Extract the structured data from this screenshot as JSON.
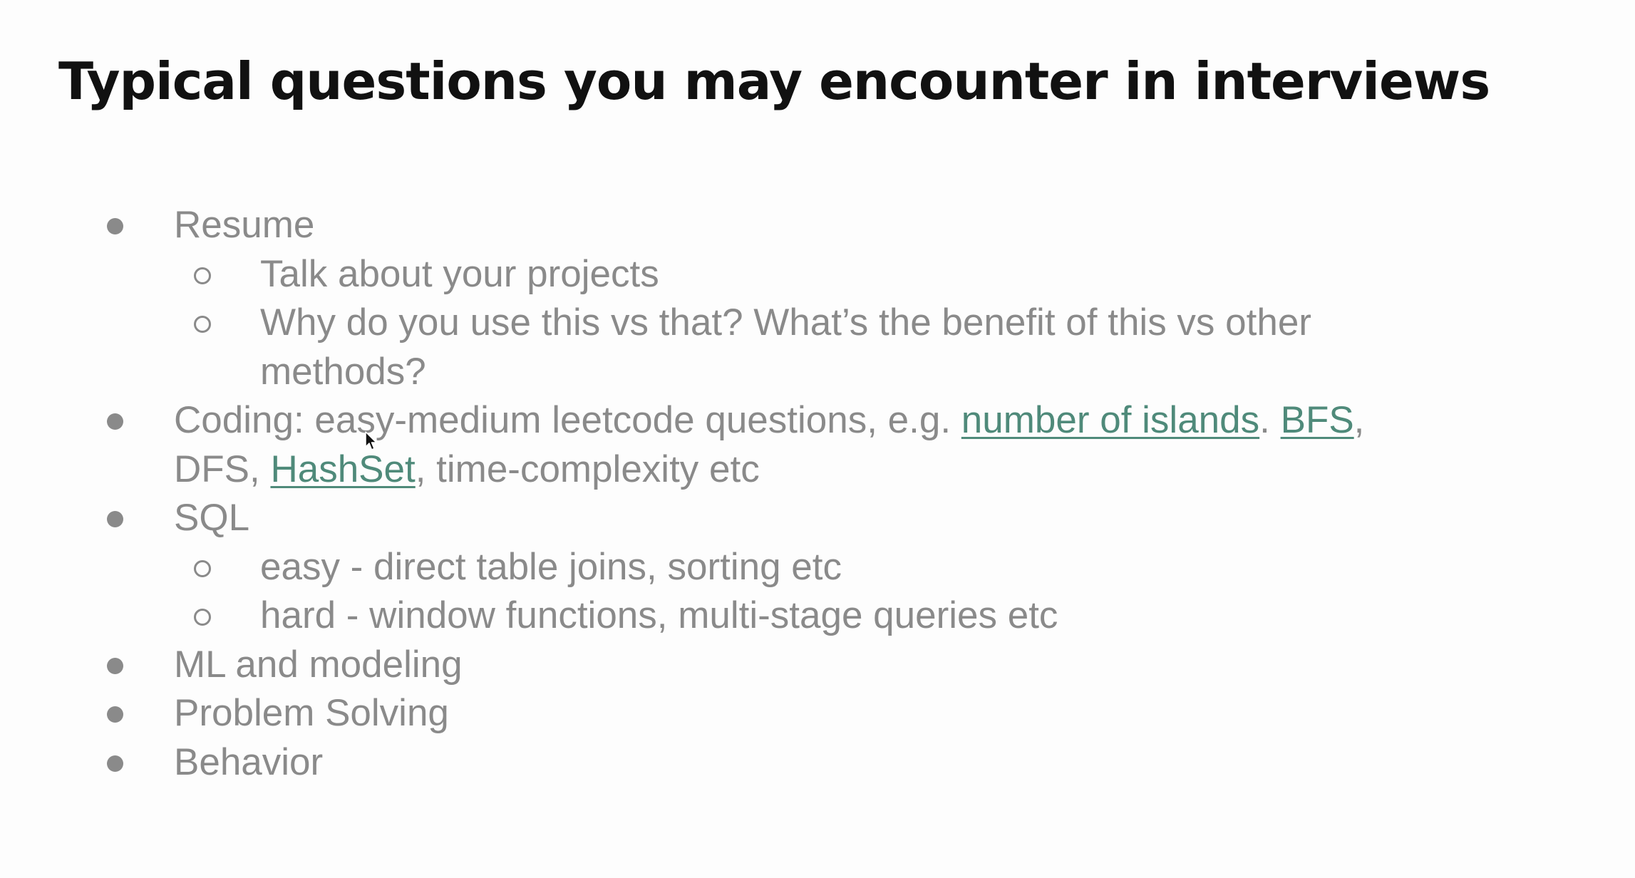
{
  "slide": {
    "title": "Typical questions you may encounter in interviews",
    "items": {
      "resume": {
        "label": "Resume",
        "sub1": "Talk about your projects",
        "sub2_line1": "Why do you use this vs that? What’s the benefit of this vs other",
        "sub2_line2": "methods?"
      },
      "coding": {
        "prefix": "Coding: easy-medium leetcode questions, e.g. ",
        "link1": "number of islands",
        "sep1": ". ",
        "link2": "BFS",
        "sep2": ",",
        "line2_prefix": "DFS, ",
        "link3": "HashSet",
        "line2_suffix": ", time-complexity etc"
      },
      "sql": {
        "label": "SQL",
        "sub1": "easy - direct table joins, sorting etc",
        "sub2": "hard - window functions, multi-stage queries etc"
      },
      "ml": {
        "label": "ML and modeling"
      },
      "problem": {
        "label": "Problem Solving"
      },
      "behavior": {
        "label": "Behavior"
      }
    }
  },
  "colors": {
    "title": "#111111",
    "body_text": "#8a8a8a",
    "link": "#4f8a7a",
    "background": "#fdfdfd"
  },
  "icons": {
    "cursor": "mouse-pointer-icon",
    "bullet_level1": "filled-circle-bullet",
    "bullet_level2": "hollow-circle-bullet"
  }
}
